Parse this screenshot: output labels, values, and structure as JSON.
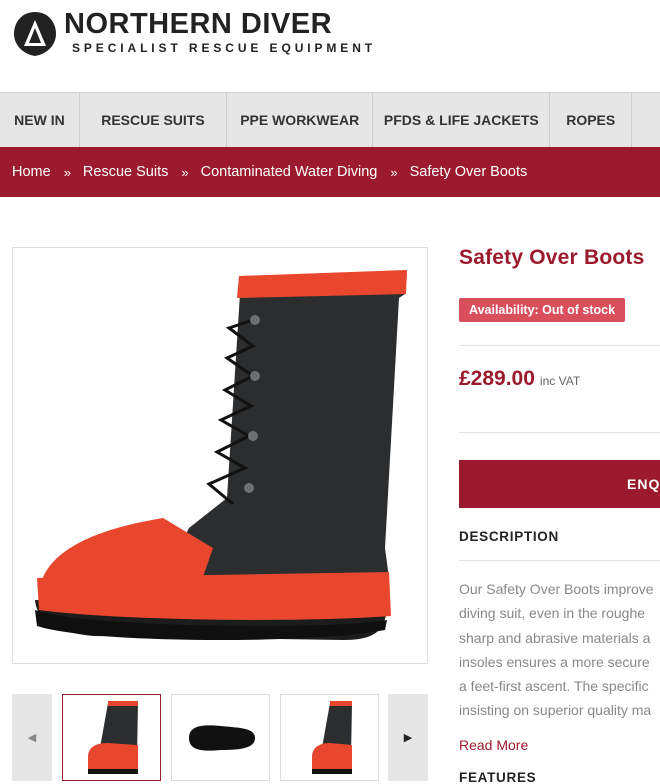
{
  "brand": {
    "name": "NORTHERN DIVER",
    "tagline": "SPECIALIST RESCUE EQUIPMENT",
    "accent_color": "#9b1a2d",
    "logo_accent_color": "#e94e1b"
  },
  "nav": {
    "items": [
      {
        "label": "NEW IN"
      },
      {
        "label": "RESCUE SUITS"
      },
      {
        "label": "PPE WORKWEAR"
      },
      {
        "label": "PFDS & LIFE JACKETS"
      },
      {
        "label": "ROPES"
      }
    ]
  },
  "breadcrumb": {
    "separator": "»",
    "items": [
      {
        "label": "Home"
      },
      {
        "label": "Rescue Suits"
      },
      {
        "label": "Contaminated Water Diving"
      },
      {
        "label": "Safety Over Boots"
      }
    ]
  },
  "product": {
    "title": "Safety Over Boots",
    "availability": "Availability: Out of stock",
    "price": "£289.00",
    "vat_note": "inc VAT",
    "enquire_label": "ENQUIRE",
    "description_heading": "DESCRIPTION",
    "description_lines": [
      "Our Safety Over Boots improve",
      "diving suit, even in the roughe",
      "sharp and abrasive materials a",
      "insoles ensures a more secure",
      "a feet-first ascent. The specific",
      "insisting on superior quality ma"
    ],
    "read_more_label": "Read More",
    "features_heading": "FEATURES"
  },
  "gallery": {
    "thumbnails": [
      {
        "icon": "boot-side-thumbnail",
        "active": true
      },
      {
        "icon": "boot-sole-thumbnail",
        "active": false
      },
      {
        "icon": "boot-pair-thumbnail",
        "active": false
      }
    ],
    "prev_icon": "chevron-left-icon",
    "next_icon": "chevron-right-icon"
  }
}
